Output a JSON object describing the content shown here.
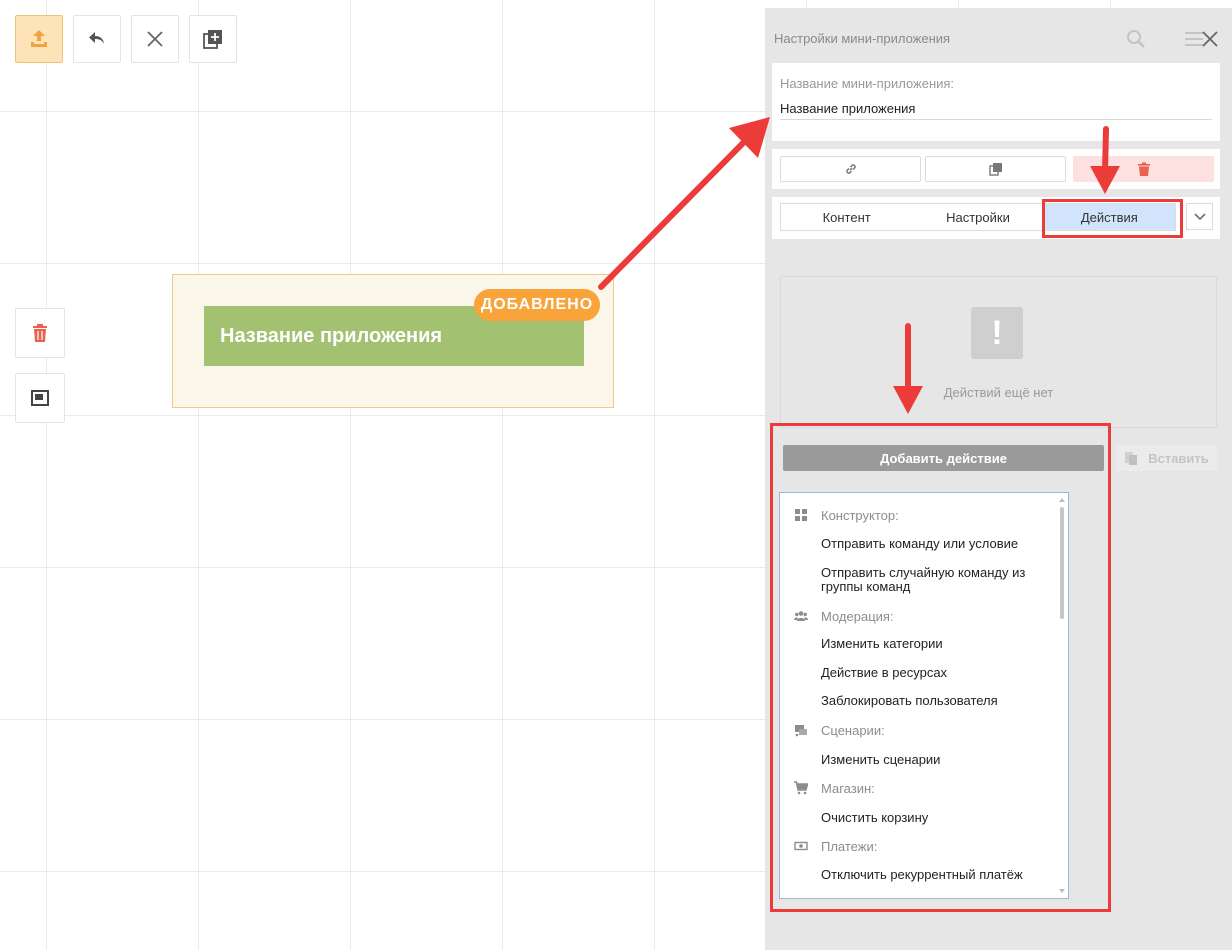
{
  "colors": {
    "accent_orange": "#f9a43b",
    "block_green": "#a2c171",
    "annotation_red": "#ec3c3a",
    "tab_selected": "#d1e4fb"
  },
  "toolbar": {
    "buttons": [
      {
        "icon": "upload-icon",
        "active": true
      },
      {
        "icon": "undo-icon"
      },
      {
        "icon": "close-icon"
      },
      {
        "icon": "add-copy-icon"
      }
    ]
  },
  "sidebar_left": {
    "buttons": [
      {
        "icon": "trash-icon"
      },
      {
        "icon": "resize-frame-icon"
      }
    ]
  },
  "canvas": {
    "block_title": "Название приложения",
    "badge": "ДОБАВЛЕНО"
  },
  "panel": {
    "title": "Настройки мини-приложения",
    "name_label": "Название мини-приложения:",
    "name_value": "Название приложения",
    "action_buttons": [
      {
        "icon": "link-icon"
      },
      {
        "icon": "copy-icon"
      },
      {
        "icon": "trash-icon"
      }
    ],
    "tabs": [
      "Контент",
      "Настройки",
      "Действия"
    ],
    "selected_tab": "Действия",
    "empty_text": "Действий ещё нет",
    "add_action_label": "Добавить действие",
    "paste_label": "Вставить"
  },
  "dropdown": {
    "groups": [
      {
        "label": "Конструктор:",
        "icon": "grid-icon",
        "items": [
          "Отправить команду или условие",
          "Отправить случайную команду из группы команд"
        ]
      },
      {
        "label": "Модерация:",
        "icon": "users-icon",
        "items": [
          "Изменить категории",
          "Действие в ресурсах",
          "Заблокировать пользователя"
        ]
      },
      {
        "label": "Сценарии:",
        "icon": "scenarios-icon",
        "items": [
          "Изменить сценарии"
        ]
      },
      {
        "label": "Магазин:",
        "icon": "cart-icon",
        "items": [
          "Очистить корзину"
        ]
      },
      {
        "label": "Платежи:",
        "icon": "money-icon",
        "items": [
          "Отключить рекуррентный платёж"
        ]
      }
    ]
  }
}
